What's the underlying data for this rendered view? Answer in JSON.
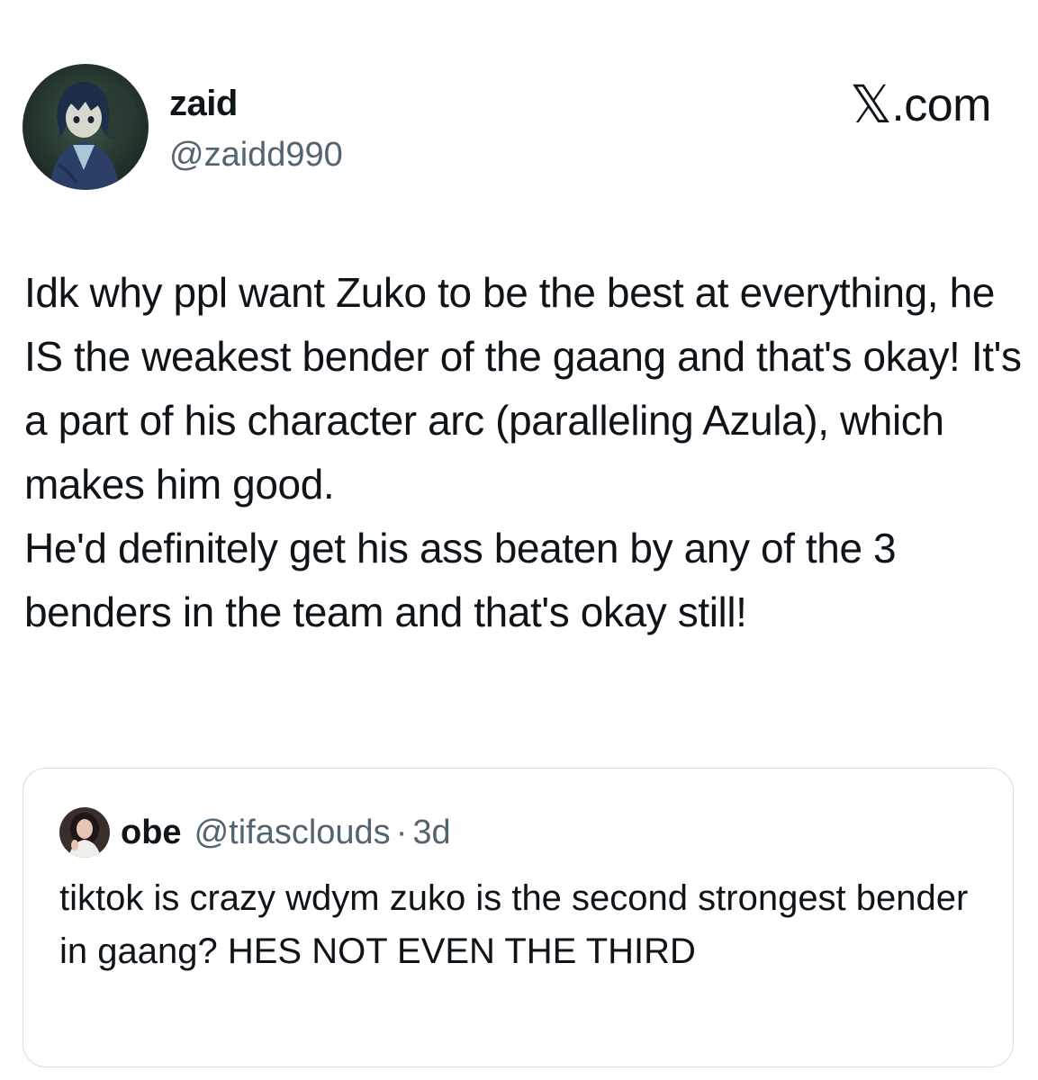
{
  "tweet": {
    "author": {
      "display_name": "zaid",
      "handle": "@zaidd990",
      "avatar_icon": "anime-avatar-icon"
    },
    "brand": {
      "x_glyph": "𝕏",
      "domain": ".com"
    },
    "text_paragraphs": [
      "Idk why ppl want Zuko to be the best at everything, he IS the weakest bender of the gaang and that's okay! It's a part of his character arc (paralleling Azula), which makes him good.",
      "He'd definitely get his ass beaten by any of the 3 benders in the team and that's okay still!"
    ]
  },
  "quoted_tweet": {
    "display_name": "obe",
    "handle": "@tifasclouds",
    "separator": "·",
    "time": "3d",
    "avatar_icon": "profile-photo-icon",
    "text": "tiktok is crazy wdym zuko is the second strongest bender in gaang? HES NOT EVEN THE THIRD"
  },
  "colors": {
    "text_primary": "#0f1419",
    "text_secondary": "#536471",
    "border": "#d7dde2"
  }
}
